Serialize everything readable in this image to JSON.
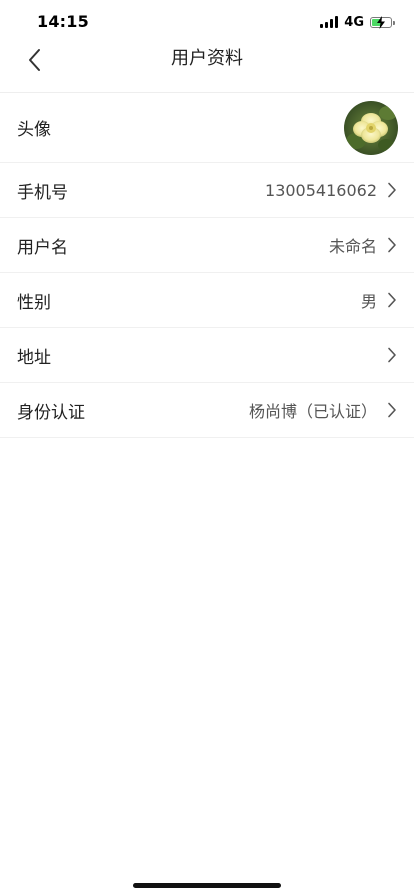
{
  "status_bar": {
    "time": "14:15",
    "network": "4G",
    "battery_level": 0.55
  },
  "nav": {
    "title": "用户资料",
    "back_icon": "chevron-left-icon"
  },
  "profile": {
    "avatar": {
      "label": "头像",
      "image": "yellow-flower-avatar"
    },
    "phone": {
      "label": "手机号",
      "value": "13005416062"
    },
    "username": {
      "label": "用户名",
      "value": "未命名"
    },
    "gender": {
      "label": "性别",
      "value": "男"
    },
    "address": {
      "label": "地址",
      "value": ""
    },
    "identity": {
      "label": "身份认证",
      "value": "杨尚博（已认证）"
    }
  },
  "colors": {
    "divider": "#f0f0f0",
    "battery_fill": "#4cd964"
  }
}
